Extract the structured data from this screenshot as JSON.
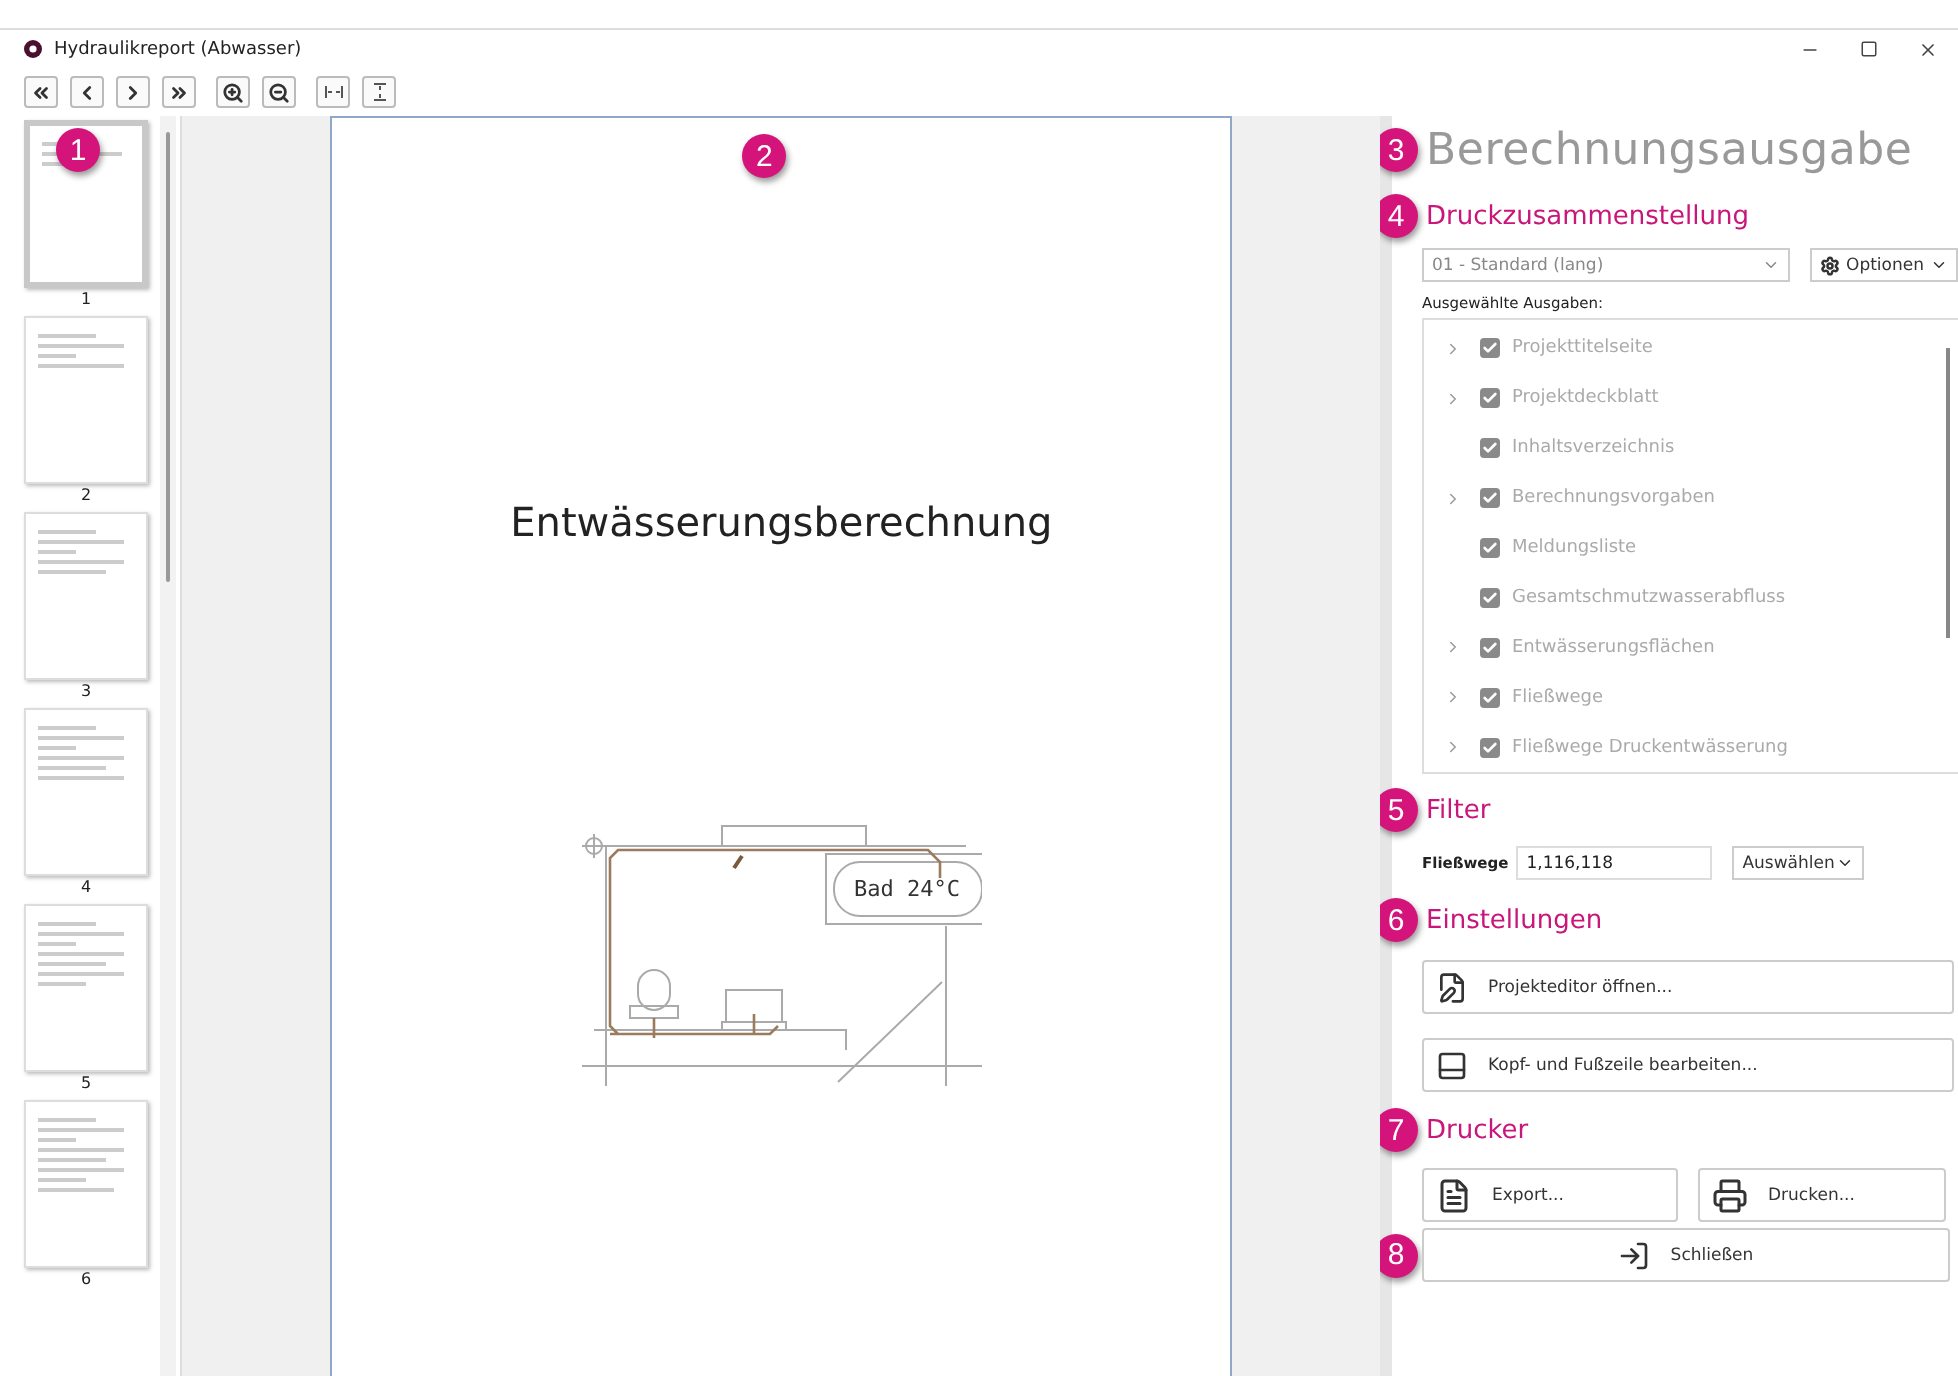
{
  "window": {
    "title": "Hydraulikreport (Abwasser)"
  },
  "toolbar": {
    "buttons": [
      {
        "kind": "first"
      },
      {
        "kind": "prev"
      },
      {
        "kind": "next"
      },
      {
        "kind": "last"
      },
      {
        "kind": "zoom-in"
      },
      {
        "kind": "zoom-out"
      },
      {
        "kind": "fit-width"
      },
      {
        "kind": "fit-height"
      }
    ]
  },
  "thumbnails": [
    {
      "label": "1",
      "selected": true
    },
    {
      "label": "2",
      "selected": false
    },
    {
      "label": "3",
      "selected": false
    },
    {
      "label": "4",
      "selected": false
    },
    {
      "label": "5",
      "selected": false
    },
    {
      "label": "6",
      "selected": false
    }
  ],
  "callouts": [
    "1",
    "2",
    "3",
    "4",
    "5",
    "6",
    "7",
    "8"
  ],
  "page": {
    "title": "Entwässerungsberechnung",
    "room_label": "Bad 24°C"
  },
  "panel": {
    "title": "Berechnungsausgabe",
    "print_set": {
      "heading": "Druckzusammenstellung",
      "preset": "01 - Standard (lang)",
      "options_button": "Optionen",
      "list_label": "Ausgewählte Ausgaben:",
      "items": [
        {
          "label": "Projekttitelseite",
          "expandable": true,
          "checked": true
        },
        {
          "label": "Projektdeckblatt",
          "expandable": true,
          "checked": true
        },
        {
          "label": "Inhaltsverzeichnis",
          "expandable": false,
          "checked": true
        },
        {
          "label": "Berechnungsvorgaben",
          "expandable": true,
          "checked": true
        },
        {
          "label": "Meldungsliste",
          "expandable": false,
          "checked": true
        },
        {
          "label": "Gesamtschmutzwasserabfluss",
          "expandable": false,
          "checked": true
        },
        {
          "label": "Entwässerungsflächen",
          "expandable": true,
          "checked": true
        },
        {
          "label": "Fließwege",
          "expandable": true,
          "checked": true
        },
        {
          "label": "Fließwege Druckentwässerung",
          "expandable": true,
          "checked": true
        }
      ]
    },
    "filter": {
      "heading": "Filter",
      "label": "Fließwege",
      "value": "1,116,118",
      "select": "Auswählen"
    },
    "settings": {
      "heading": "Einstellungen",
      "buttons": [
        "Projekteditor öffnen...",
        "Kopf- und Fußzeile bearbeiten..."
      ]
    },
    "printer": {
      "heading": "Drucker",
      "export": "Export...",
      "print": "Drucken..."
    },
    "close": "Schließen"
  }
}
